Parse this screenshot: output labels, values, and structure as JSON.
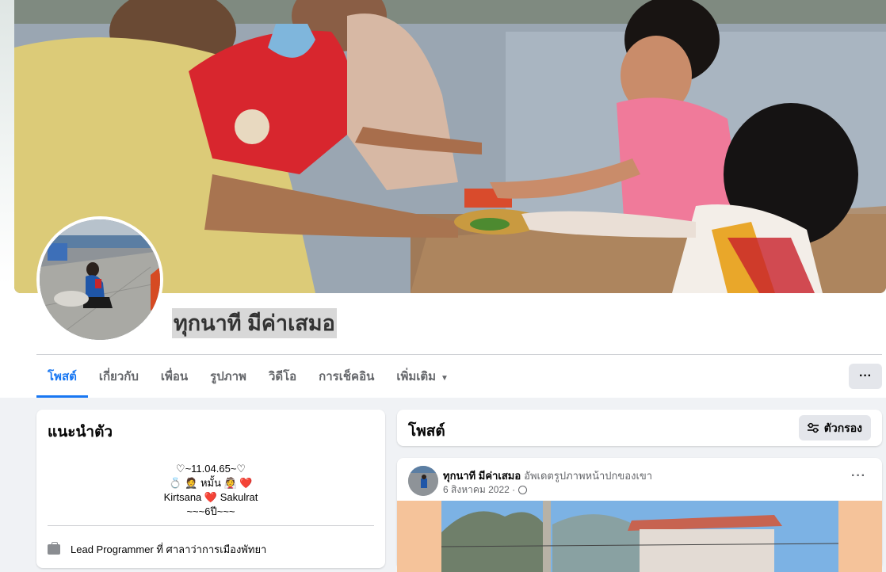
{
  "profile": {
    "name": "ทุกนาที มีค่าเสมอ"
  },
  "nav": {
    "tabs": [
      {
        "label": "โพสต์",
        "active": true
      },
      {
        "label": "เกี่ยวกับ",
        "active": false
      },
      {
        "label": "เพื่อน",
        "active": false
      },
      {
        "label": "รูปภาพ",
        "active": false
      },
      {
        "label": "วิดีโอ",
        "active": false
      },
      {
        "label": "การเช็คอิน",
        "active": false
      },
      {
        "label": "เพิ่มเติม",
        "active": false
      }
    ],
    "more_icon": "ellipsis-icon",
    "more_label": "···"
  },
  "intro": {
    "title": "แนะนำตัว",
    "bio_lines": [
      "♡~11.04.65~♡",
      "💍 🤵 หมั้น 👰 ❤️",
      "Kirtsana ❤️ Sakulrat",
      "~~~6ปี~~~"
    ],
    "work": "Lead Programmer ที่ ศาลาว่าการเมืองพัทยา",
    "work_icon": "briefcase-icon"
  },
  "posts": {
    "title": "โพสต์",
    "filter_label": "ตัวกรอง",
    "filter_icon": "filter-icon"
  },
  "post": {
    "author": "ทุกนาที มีค่าเสมอ",
    "action": "อัพเดตรูปภาพหน้าปกของเขา",
    "date": "6 สิงหาคม 2022 ·",
    "menu_label": "···"
  },
  "colors": {
    "accent": "#1877f2",
    "page_bg": "#f0f2f5",
    "button_bg": "#e4e6eb",
    "muted_text": "#65676b"
  }
}
